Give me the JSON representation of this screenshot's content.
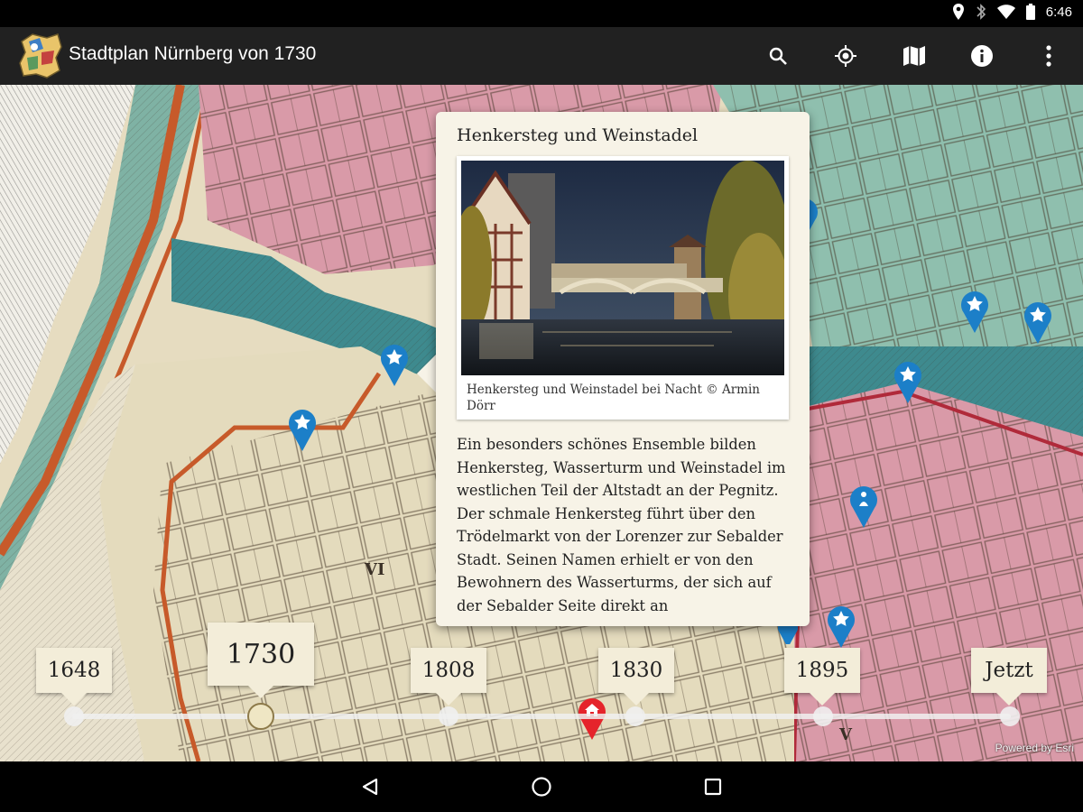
{
  "status_bar": {
    "time": "6:46",
    "icons": [
      "location-icon",
      "bluetooth-icon",
      "wifi-icon",
      "battery-icon"
    ]
  },
  "app_bar": {
    "title": "Stadtplan Nürnberg von 1730",
    "actions": [
      "search-icon",
      "my-location-icon",
      "map-icon",
      "info-icon",
      "more-vert-icon"
    ]
  },
  "popup": {
    "title": "Henkersteg und Weinstadel",
    "image_caption": "Henkersteg und Weinstadel bei Nacht © Armin Dörr",
    "description": "Ein besonders schönes Ensemble bilden Henkersteg, Wasserturm und Weinstadel im westlichen Teil der Altstadt an der Pegnitz. Der schmale Henkersteg führt über den Trödelmarkt von der Lorenzer zur Sebalder Stadt. Seinen Namen erhielt er von den Bewohnern des Wasserturms, der sich auf der Sebalder Seite direkt an"
  },
  "map": {
    "district_labels": [
      "VI",
      "V"
    ],
    "powered_by": "Powered by Esri"
  },
  "timeline": {
    "selected": "1730",
    "years": [
      "1648",
      "1730",
      "1808",
      "1830",
      "1895",
      "Jetzt"
    ]
  },
  "colors": {
    "app_bar": "#212121",
    "pin_blue": "#1c7fc8",
    "pin_red": "#e5242b",
    "popup_bg": "#f7f3e7",
    "map_pink": "#d99aa8",
    "map_teal": "#7fb2a4",
    "water": "#3e8a8e"
  }
}
